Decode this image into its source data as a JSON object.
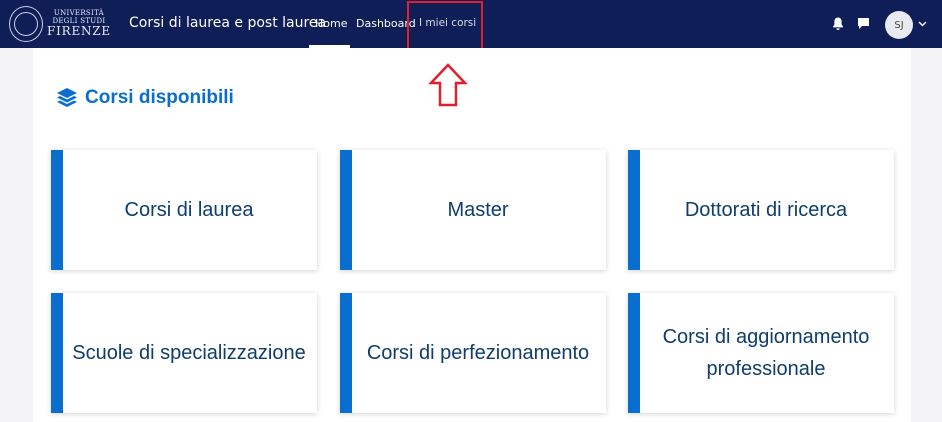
{
  "header": {
    "logo": {
      "line1": "UNIVERSITÀ",
      "line2": "DEGLI STUDI",
      "line3": "FIRENZE"
    },
    "brand": "Corsi di laurea e post laurea",
    "nav": {
      "home": "Home",
      "dashboard": "Dashboard",
      "my_courses": "I miei corsi"
    },
    "user_initials": "SJ",
    "icons": [
      "bell-icon",
      "chat-icon",
      "chevron-down-icon"
    ]
  },
  "main": {
    "title": "Corsi disponibili",
    "title_icon": "layers-icon",
    "cards": [
      {
        "label": "Corsi di laurea"
      },
      {
        "label": "Master"
      },
      {
        "label": "Dottorati di ricerca"
      },
      {
        "label": "Scuole di specializzazione"
      },
      {
        "label": "Corsi di perfezionamento"
      },
      {
        "label": "Corsi di aggiornamento professionale"
      }
    ]
  },
  "colors": {
    "navbar": "#0f1e57",
    "accent": "#0a6ecf",
    "card_text": "#0f3d6e",
    "annotation": "#e3202a"
  }
}
